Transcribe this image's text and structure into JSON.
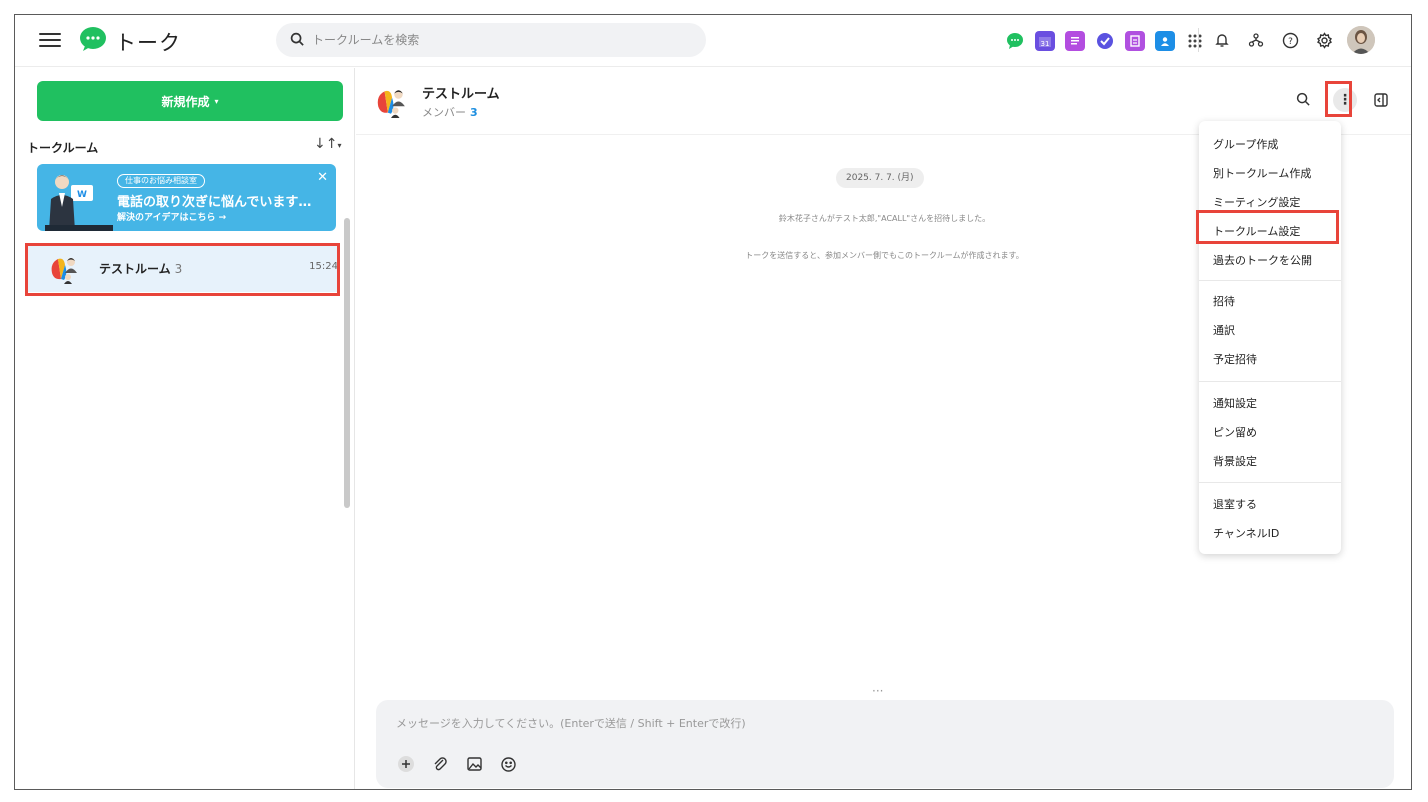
{
  "app": {
    "title": "トーク"
  },
  "search": {
    "placeholder": "トークルームを検索"
  },
  "sidebar": {
    "new_button": "新規作成",
    "section_title": "トークルーム",
    "banner": {
      "tag": "仕事のお悩み相談室",
      "headline": "電話の取り次ぎに悩んでいます…",
      "sub": "解決のアイデアはこちら →"
    },
    "rooms": [
      {
        "name": "テストルーム",
        "count": "3",
        "time": "15:24"
      }
    ]
  },
  "chat": {
    "title": "テストルーム",
    "member_label": "メンバー",
    "member_count": "3",
    "date": "2025. 7. 7. (月)",
    "system_messages": [
      "鈴木花子さんがテスト太郎,\"ACALL\"さんを招待しました。",
      "トークを送信すると、参加メンバー側でもこのトークルームが作成されます。"
    ],
    "composer_placeholder": "メッセージを入力してください。(Enterで送信 / Shift + Enterで改行)",
    "ellipsis": "···"
  },
  "menu": {
    "groups": [
      [
        "グループ作成",
        "別トークルーム作成",
        "ミーティング設定",
        "トークルーム設定",
        "過去のトークを公開"
      ],
      [
        "招待",
        "通訳",
        "予定招待"
      ],
      [
        "通知設定",
        "ピン留め",
        "背景設定"
      ],
      [
        "退室する",
        "チャンネルID"
      ]
    ]
  },
  "icons": {
    "top_apps": [
      "talk-icon",
      "calendar-icon",
      "note-icon",
      "task-icon",
      "survey-icon",
      "address-book-icon",
      "apps-grid-icon"
    ],
    "top_tools": [
      "bell-icon",
      "org-chart-icon",
      "help-icon",
      "settings-icon"
    ],
    "composer_tools": [
      "plus-icon",
      "attach-icon",
      "image-icon",
      "emoji-icon"
    ]
  },
  "colors": {
    "brand_green": "#20c060",
    "highlight_red": "#e8443a",
    "banner_blue": "#45b5e6",
    "selected_room_bg": "#e7f2fb"
  }
}
